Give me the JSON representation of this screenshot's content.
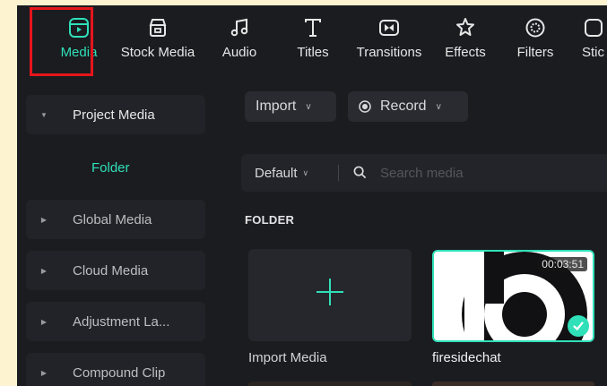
{
  "toolbar": {
    "items": [
      {
        "label": "Media",
        "icon": "media-icon",
        "active": true
      },
      {
        "label": "Stock Media",
        "icon": "stock-media-icon"
      },
      {
        "label": "Audio",
        "icon": "audio-icon"
      },
      {
        "label": "Titles",
        "icon": "titles-icon"
      },
      {
        "label": "Transitions",
        "icon": "transitions-icon"
      },
      {
        "label": "Effects",
        "icon": "effects-icon"
      },
      {
        "label": "Filters",
        "icon": "filters-icon"
      },
      {
        "label": "Stic",
        "icon": "stickers-icon"
      }
    ]
  },
  "sidebar": {
    "items": [
      {
        "label": "Project Media",
        "expanded": true
      },
      {
        "label": "Folder",
        "selected": true
      },
      {
        "label": "Global Media"
      },
      {
        "label": "Cloud Media"
      },
      {
        "label": "Adjustment La..."
      },
      {
        "label": "Compound Clip"
      }
    ]
  },
  "main": {
    "import_label": "Import",
    "record_label": "Record",
    "sort_label": "Default",
    "search_placeholder": "Search media",
    "section_label": "FOLDER",
    "import_card_label": "Import Media",
    "clip": {
      "name": "firesidechat",
      "duration": "00:03:51",
      "selected": true
    }
  },
  "colors": {
    "accent": "#2fe0b9",
    "highlight": "#e5151b",
    "background": "#1b1c20",
    "page_bg": "#fdf3d0"
  }
}
